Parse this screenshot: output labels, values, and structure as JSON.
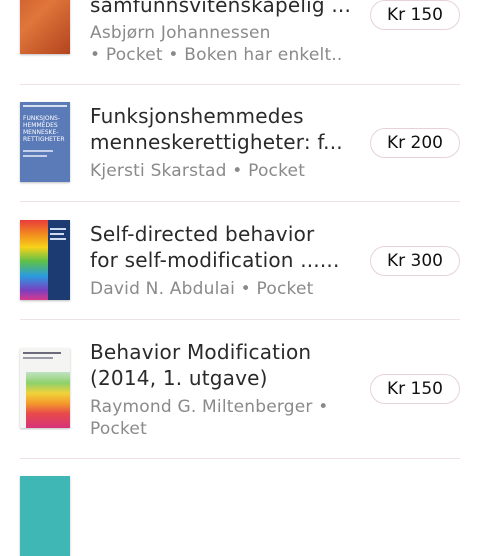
{
  "items": [
    {
      "title_lines": [
        "samfunnsvitenskapelig ..."
      ],
      "author": "Asbjørn Johannessen",
      "format": "Pocket",
      "note": "Boken har enkelt..",
      "price": "Kr 150"
    },
    {
      "title_lines": [
        "Funksjonshemmedes",
        "menneskerettigheter: f..."
      ],
      "author": "Kjersti Skarstad",
      "format": "Pocket",
      "price": "Kr 200",
      "cover_text": [
        "FUNKSJONS-",
        "HEMMEDES",
        "MENNESKE-",
        "RETTIGHETER"
      ]
    },
    {
      "title_lines": [
        "Self-directed behavior",
        "for self-modification ......"
      ],
      "author": "David N. Abdulai",
      "format": "Pocket",
      "price": "Kr 300"
    },
    {
      "title_lines": [
        "Behavior Modification",
        "(2014, 1. utgave)"
      ],
      "author": "Raymond G. Miltenberger",
      "format": "Pocket",
      "price": "Kr 150"
    }
  ],
  "bullet": "•"
}
